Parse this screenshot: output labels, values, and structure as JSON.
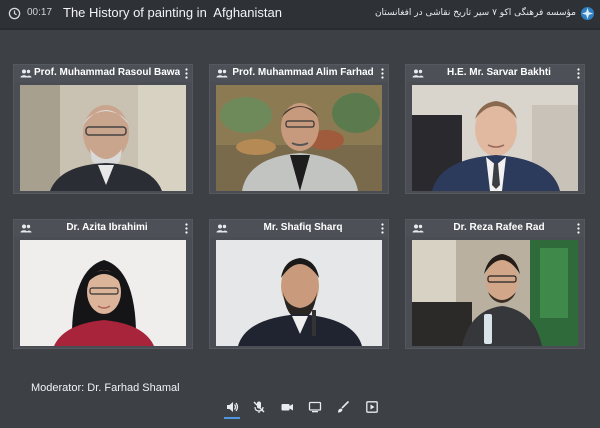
{
  "header": {
    "timer": "00:17",
    "title": "The History of painting in  Afghanistan",
    "title_fa": "مؤسسه فرهنگی اکو ۷ سیر تاریخ نقاشی در افغانستان"
  },
  "participants": [
    {
      "name": "Prof. Muhammad Rasoul Bawari",
      "icon": "people-icon"
    },
    {
      "name": "Prof. Muhammad Alim Farhad",
      "icon": "people-icon"
    },
    {
      "name": "H.E. Mr. Sarvar Bakhti",
      "icon": "people-icon"
    },
    {
      "name": "Dr. Azita Ibrahimi",
      "icon": "people-icon"
    },
    {
      "name": "Mr. Shafiq Sharq",
      "icon": "people-icon"
    },
    {
      "name": "Dr. Reza Rafee Rad",
      "icon": "people-icon"
    }
  ],
  "footer": {
    "moderator": "Moderator: Dr. Farhad Shamal"
  },
  "controls": [
    {
      "icon": "speaker-icon",
      "active": true
    },
    {
      "icon": "mic-muted-icon",
      "active": false
    },
    {
      "icon": "camera-icon",
      "active": false
    },
    {
      "icon": "screen-share-icon",
      "active": false
    },
    {
      "icon": "brush-icon",
      "active": false
    },
    {
      "icon": "present-icon",
      "active": false
    }
  ],
  "colors": {
    "background": "#3d4045",
    "topbar": "#2e3136",
    "accent": "#4f95e0"
  }
}
